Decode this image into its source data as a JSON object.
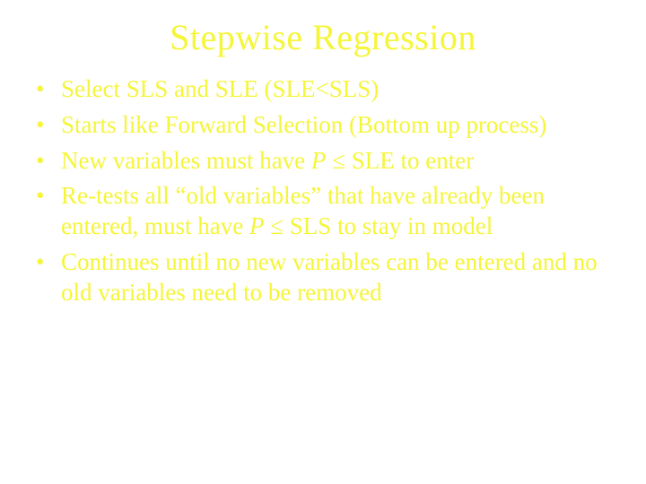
{
  "title": "Stepwise Regression",
  "bullets": {
    "b1": "Select SLS and SLE (SLE<SLS)",
    "b2": "Starts like Forward Selection (Bottom up process)",
    "b3_pre": "New variables must have ",
    "b3_var": "P",
    "b3_post": " ≤ SLE to enter",
    "b4_pre": "Re-tests all “old variables” that have already been entered, must have ",
    "b4_var": "P",
    "b4_post": " ≤ SLS to stay in model",
    "b5": "Continues until no new variables can be entered and no old variables need to be removed"
  }
}
